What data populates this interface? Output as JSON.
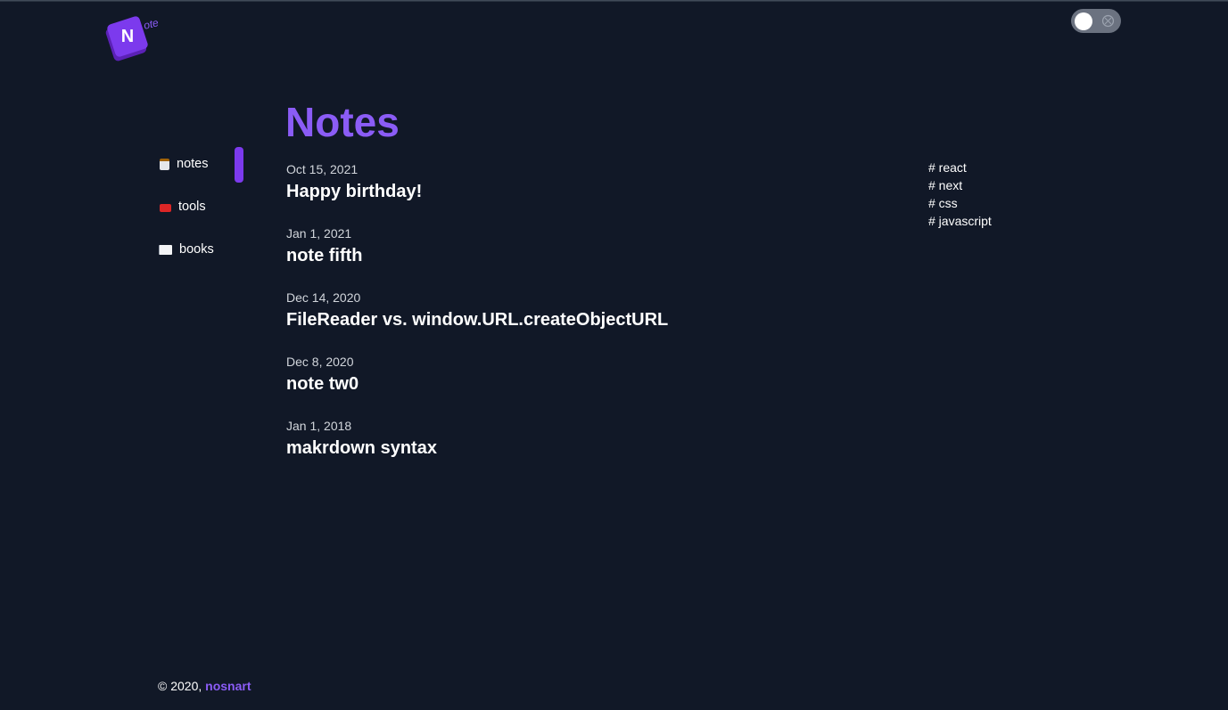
{
  "header": {
    "logo_letter": "N",
    "logo_rest": "ote"
  },
  "colors": {
    "accent": "#8b5cf6",
    "background": "#111827",
    "toggle": "#6b7280"
  },
  "sidebar": {
    "items": [
      {
        "label": "notes",
        "icon": "clipboard-icon",
        "active": true
      },
      {
        "label": "tools",
        "icon": "toolbox-icon",
        "active": false
      },
      {
        "label": "books",
        "icon": "book-icon",
        "active": false
      }
    ]
  },
  "main": {
    "title": "Notes",
    "notes": [
      {
        "date": "Oct 15, 2021",
        "title": "Happy birthday!"
      },
      {
        "date": "Jan 1, 2021",
        "title": "note fifth"
      },
      {
        "date": "Dec 14, 2020",
        "title": "FileReader vs. window.URL.createObjectURL"
      },
      {
        "date": "Dec 8, 2020",
        "title": "note tw0"
      },
      {
        "date": "Jan 1, 2018",
        "title": "makrdown syntax"
      }
    ]
  },
  "tags": [
    "# react",
    "# next",
    "# css",
    "# javascript"
  ],
  "footer": {
    "copyright": "© 2020, ",
    "author": "nosnart"
  }
}
